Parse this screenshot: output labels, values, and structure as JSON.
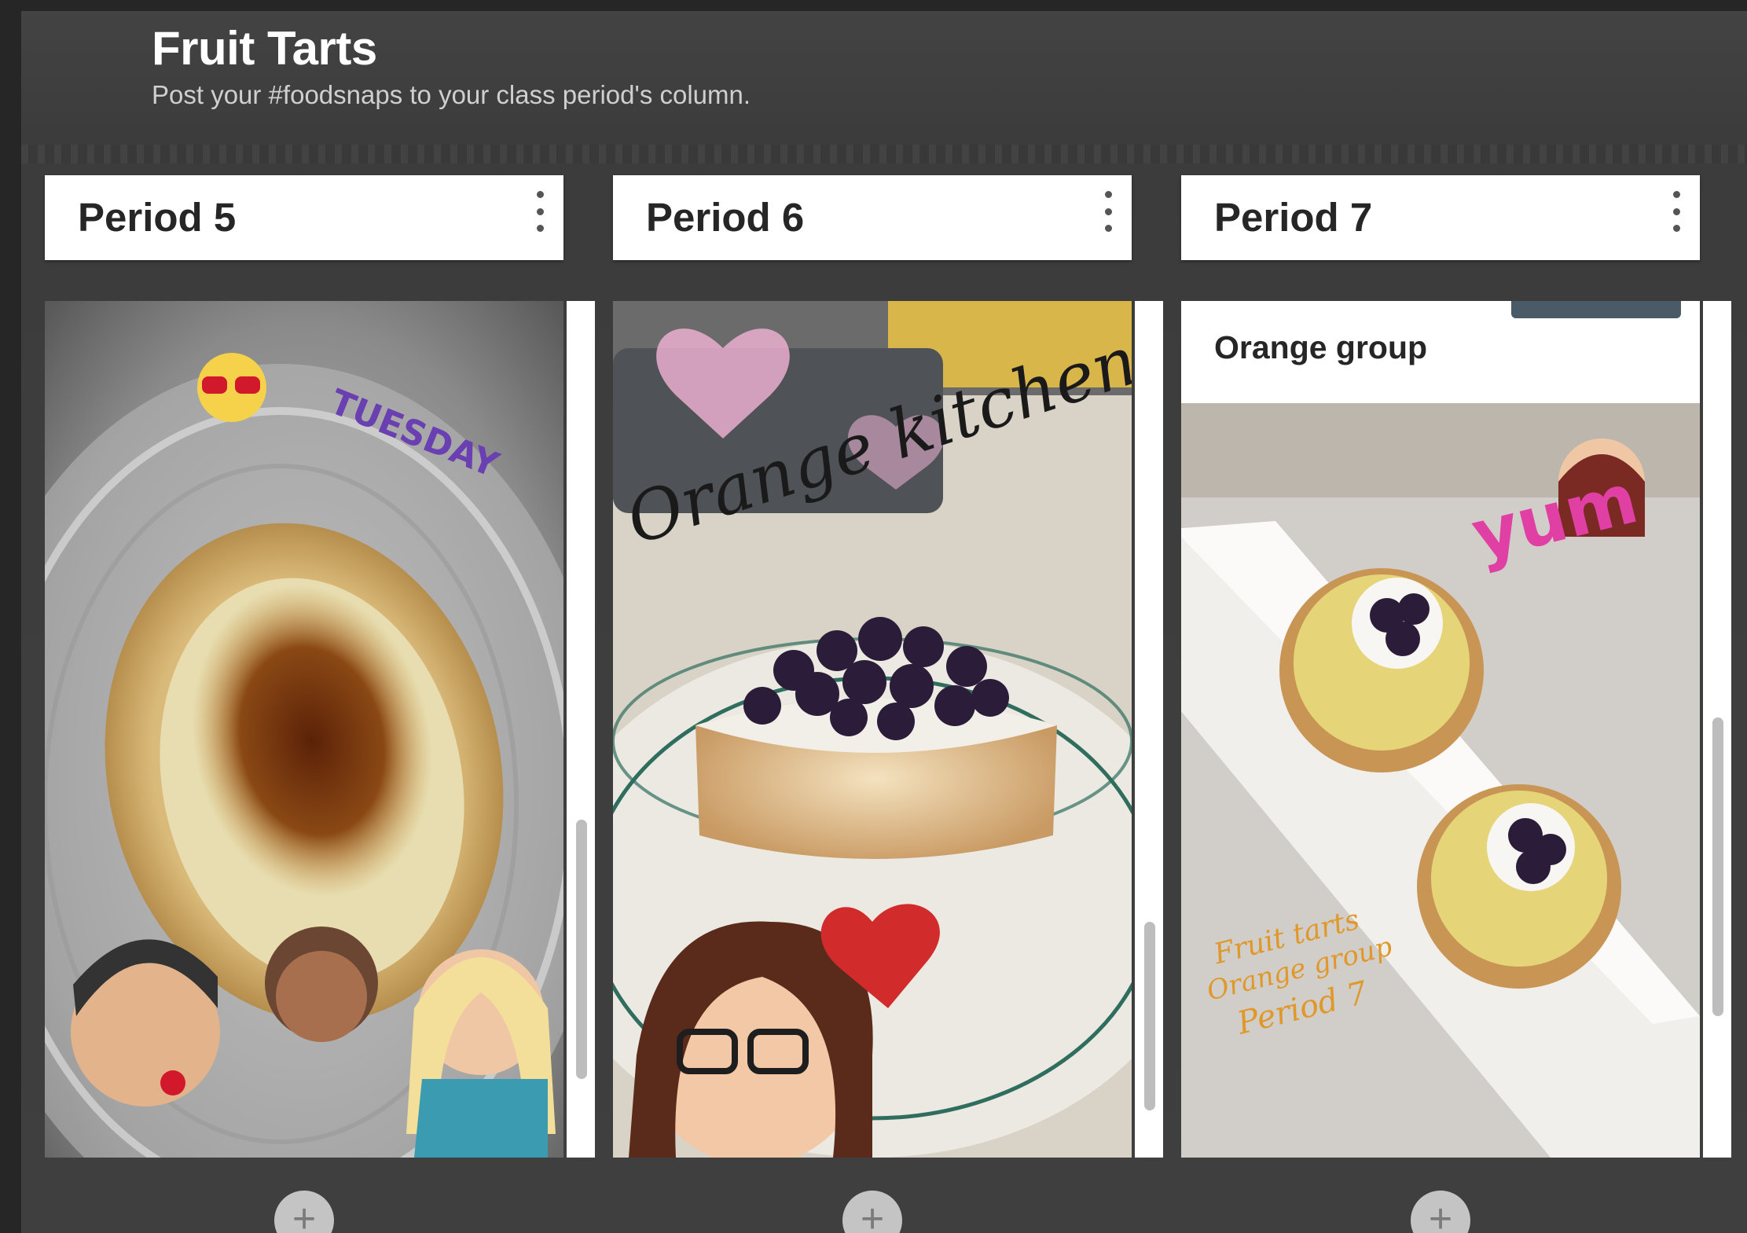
{
  "board": {
    "title": "Fruit Tarts",
    "subtitle": "Post your #foodsnaps to your class period's column."
  },
  "columns": [
    {
      "title": "Period 5",
      "menu_icon": "kebab-menu-icon",
      "add_icon": "plus-icon",
      "add_label": "+",
      "post": {
        "sticker_text": "TUESDAY"
      }
    },
    {
      "title": "Period 6",
      "menu_icon": "kebab-menu-icon",
      "add_icon": "plus-icon",
      "add_label": "+",
      "post": {
        "overlay_text": "Orange kitchen"
      }
    },
    {
      "title": "Period 7",
      "menu_icon": "kebab-menu-icon",
      "add_icon": "plus-icon",
      "add_label": "+",
      "post": {
        "label": "Orange group",
        "sticker_text": "yum",
        "caption_lines": [
          "Fruit tarts",
          "Orange group",
          "Period 7"
        ]
      }
    }
  ],
  "colors": {
    "background": "#262626",
    "board": "#3f3f3f",
    "header_bg": "#ffffff",
    "add_button": "#c4c4c4"
  }
}
